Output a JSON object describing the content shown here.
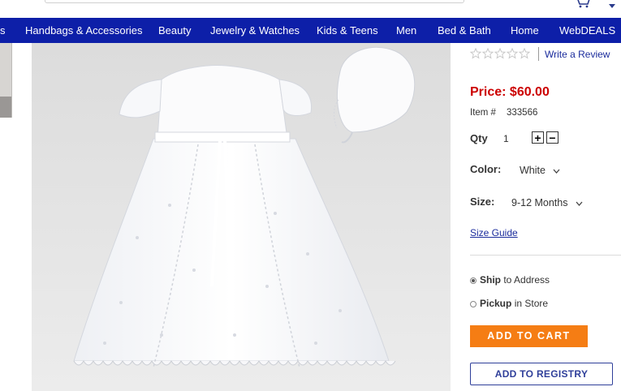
{
  "nav": {
    "items": [
      "s",
      "Handbags & Accessories",
      "Beauty",
      "Jewelry & Watches",
      "Kids & Teens",
      "Men",
      "Bed & Bath",
      "Home",
      "WebDEALS"
    ]
  },
  "colors": {
    "nav_bg": "#0d1fa8",
    "price": "#cc0000",
    "add_to_cart_bg": "#f57d14",
    "link": "#1a2b9c"
  },
  "icons": {
    "cart": "cart-icon",
    "menu_chevron": "chevron-down-icon",
    "stars": "star-outline-icon"
  },
  "product": {
    "image_alt": "White christening gown with bonnet",
    "rating": {
      "stars_filled": 0,
      "stars_total": 5,
      "write_review": "Write a Review"
    },
    "price": "Price: $60.00",
    "item_label": "Item #",
    "item_number": "333566",
    "qty_label": "Qty",
    "qty_value": "1",
    "qty_plus": "+",
    "qty_minus": "−",
    "color_label": "Color:",
    "color_value": "White",
    "size_label": "Size:",
    "size_value": "9-12 Months",
    "size_guide": "Size Guide",
    "fulfillment": {
      "ship_bold": "Ship",
      "ship_rest": " to Address",
      "pickup_bold": "Pickup",
      "pickup_rest": " in Store",
      "selected": "ship"
    },
    "add_to_cart": "ADD TO CART",
    "add_to_registry": "ADD TO REGISTRY"
  }
}
